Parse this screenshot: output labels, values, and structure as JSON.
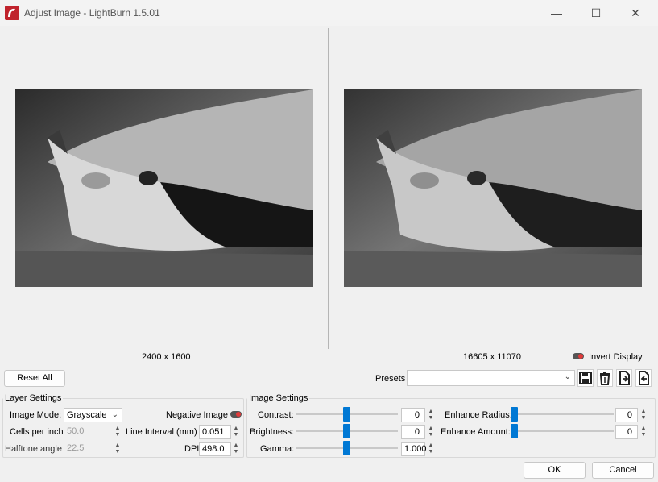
{
  "window": {
    "title": "Adjust Image - LightBurn 1.5.01",
    "minimize_glyph": "—",
    "maximize_glyph": "☐",
    "close_glyph": "✕"
  },
  "preview": {
    "original_size": "2400 x 1600",
    "result_size": "16605 x 11070",
    "invert_display_label": "Invert Display"
  },
  "actions": {
    "reset_all": "Reset All",
    "presets_label": "Presets",
    "presets_value": "",
    "ok": "OK",
    "cancel": "Cancel"
  },
  "preset_icons": [
    "save-icon",
    "delete-icon",
    "import-icon",
    "export-icon"
  ],
  "layer_settings": {
    "title": "Layer Settings",
    "image_mode_label": "Image Mode:",
    "image_mode_value": "Grayscale",
    "negative_image_label": "Negative Image",
    "cells_per_inch_label": "Cells per inch",
    "cells_per_inch_value": "50.0",
    "line_interval_label": "Line Interval (mm)",
    "line_interval_value": "0.051",
    "halftone_angle_label": "Halftone angle",
    "halftone_angle_value": "22.5",
    "dpi_label": "DPI",
    "dpi_value": "498.0"
  },
  "image_settings": {
    "title": "Image Settings",
    "contrast_label": "Contrast:",
    "contrast_value": "0",
    "brightness_label": "Brightness:",
    "brightness_value": "0",
    "gamma_label": "Gamma:",
    "gamma_value": "1.000",
    "enhance_radius_label": "Enhance Radius:",
    "enhance_radius_value": "0",
    "enhance_amount_label": "Enhance Amount:",
    "enhance_amount_value": "0"
  },
  "colors": {
    "accent": "#0078d4",
    "toggle_off_dot": "#e23b3b",
    "app_icon": "#c0232c"
  }
}
